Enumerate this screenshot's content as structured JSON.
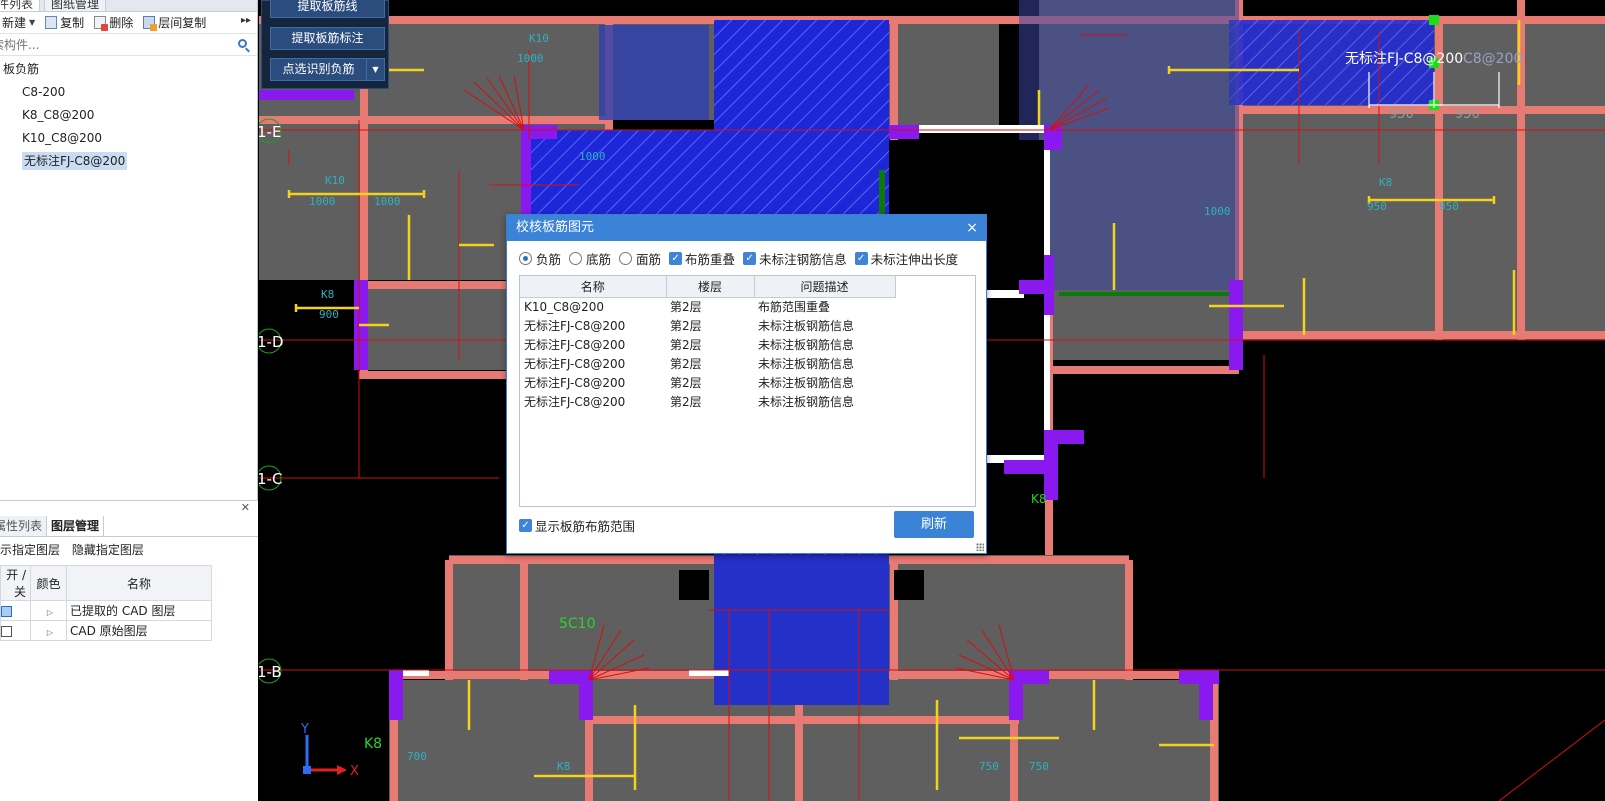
{
  "left_panel": {
    "tabs": [
      "构件列表",
      "图纸管理"
    ],
    "toolbar": {
      "new_label": "新建",
      "copy_label": "复制",
      "delete_label": "删除",
      "layer_copy_label": "层间复制"
    },
    "search_placeholder": "搜索构件...",
    "tree": {
      "group": "板负筋",
      "items": [
        "C8-200",
        "K8_C8@200",
        "K10_C8@200",
        "无标注FJ-C8@200"
      ],
      "selected_index": 3
    }
  },
  "attr_panel": {
    "tabs": [
      "属性列表",
      "图层管理"
    ],
    "active_tab": "图层管理",
    "actions": [
      "显示指定图层",
      "隐藏指定图层"
    ],
    "columns": [
      "开 / 关",
      "颜色",
      "名称"
    ],
    "rows": [
      {
        "name": "已提取的 CAD 图层",
        "checked": true
      },
      {
        "name": "CAD 原始图层",
        "checked": false
      }
    ]
  },
  "float_panel": {
    "buttons": [
      "提取板筋线",
      "提取板筋标注",
      "点选识别负筋"
    ]
  },
  "dialog": {
    "title": "校核板筋图元",
    "close": "×",
    "radios": [
      {
        "label": "负筋",
        "checked": true
      },
      {
        "label": "底筋",
        "checked": false
      },
      {
        "label": "面筋",
        "checked": false
      }
    ],
    "checkboxes": [
      {
        "label": "布筋重叠",
        "checked": true
      },
      {
        "label": "未标注钢筋信息",
        "checked": true
      },
      {
        "label": "未标注伸出长度",
        "checked": true
      }
    ],
    "columns": [
      "名称",
      "楼层",
      "问题描述"
    ],
    "rows": [
      {
        "name": "K10_C8@200",
        "floor": "第2层",
        "issue": "布筋范围重叠"
      },
      {
        "name": "无标注FJ-C8@200",
        "floor": "第2层",
        "issue": "未标注板钢筋信息"
      },
      {
        "name": "无标注FJ-C8@200",
        "floor": "第2层",
        "issue": "未标注板钢筋信息"
      },
      {
        "name": "无标注FJ-C8@200",
        "floor": "第2层",
        "issue": "未标注板钢筋信息"
      },
      {
        "name": "无标注FJ-C8@200",
        "floor": "第2层",
        "issue": "未标注板钢筋信息"
      },
      {
        "name": "无标注FJ-C8@200",
        "floor": "第2层",
        "issue": "未标注板钢筋信息"
      }
    ],
    "show_range_label": "显示板筋布筋范围",
    "show_range_checked": true,
    "refresh_label": "刷新"
  },
  "canvas": {
    "axis_labels": [
      "1-E",
      "1-D",
      "1-C",
      "1-B"
    ],
    "top_label": "无标注FJ-C8@200",
    "top_label_suffix": "C8@200",
    "dims": [
      "950",
      "950"
    ],
    "misc_labels": [
      "5C10",
      "K8",
      "K8"
    ],
    "ucs": {
      "y": "Y",
      "x": "X"
    }
  }
}
